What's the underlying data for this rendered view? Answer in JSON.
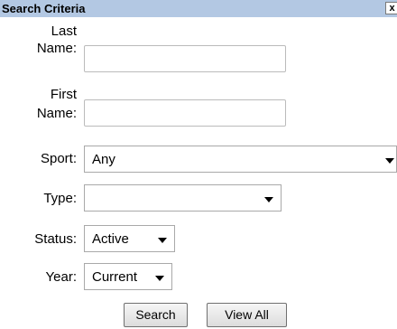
{
  "header": {
    "title": "Search Criteria",
    "close_label": "x"
  },
  "form": {
    "last_name": {
      "label_line1": "Last",
      "label_line2": "Name:",
      "value": ""
    },
    "first_name": {
      "label_line1": "First",
      "label_line2": "Name:",
      "value": ""
    },
    "sport": {
      "label": "Sport:",
      "selected": "Any"
    },
    "type": {
      "label": "Type:",
      "selected": ""
    },
    "status": {
      "label": "Status:",
      "selected": "Active"
    },
    "year": {
      "label": "Year:",
      "selected": "Current"
    }
  },
  "buttons": {
    "search": "Search",
    "view_all": "View All"
  },
  "colors": {
    "header_bg": "#b3c8e3"
  }
}
